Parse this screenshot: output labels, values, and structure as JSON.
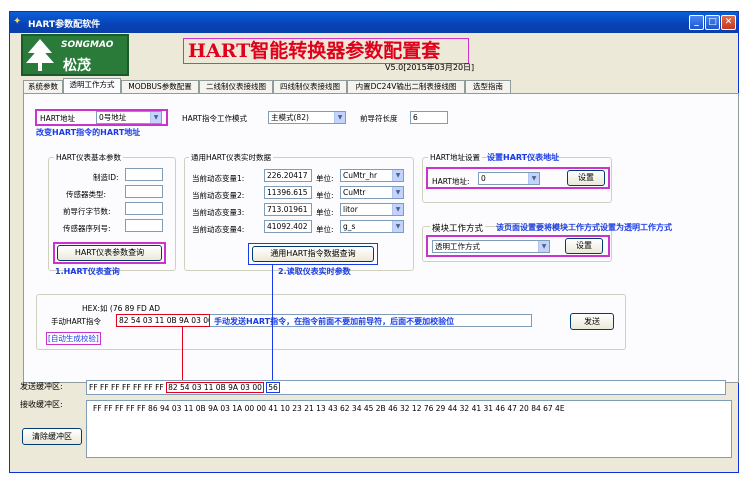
{
  "window": {
    "title": "HART参数配软件",
    "minimize_glyph": "_",
    "maximize_glyph": "□",
    "close_glyph": "✕"
  },
  "logo": {
    "brand": "SONGMAO",
    "brand_cn": "松茂"
  },
  "app_title": "HART智能转换器参数配置套",
  "version": "V5.0[2015年03月20日]",
  "tabs": [
    {
      "label": "系统参数"
    },
    {
      "label": "透明工作方式"
    },
    {
      "label": "MODBUS参数配置"
    },
    {
      "label": "二线制仪表接线图"
    },
    {
      "label": "四线制仪表接线图"
    },
    {
      "label": "内置DC24V输出二制表接线图"
    },
    {
      "label": "选型指南"
    }
  ],
  "hart_address": {
    "label": "HART地址",
    "value": "0号地址",
    "note": "改变HART指令的HART地址"
  },
  "work_mode": {
    "label": "HART指令工作模式",
    "value": "主模式(82)"
  },
  "preamble": {
    "label": "前导符长度",
    "value": "6"
  },
  "basic_params": {
    "title": "HART仪表基本参数",
    "rows": [
      {
        "label": "制造ID:",
        "value": ""
      },
      {
        "label": "传感器类型:",
        "value": ""
      },
      {
        "label": "前导行字节数:",
        "value": ""
      },
      {
        "label": "传感器序列号:",
        "value": ""
      }
    ],
    "query_button": "HART仪表参数查询",
    "note": "1.HART仪表查询"
  },
  "realtime": {
    "title": "通用HART仪表实时数据",
    "rows": [
      {
        "label": "当前动态变量1:",
        "value": "226.20417",
        "unit_label": "单位:",
        "unit": "CuMtr_hr"
      },
      {
        "label": "当前动态变量2:",
        "value": "11396.615",
        "unit_label": "单位:",
        "unit": "CuMtr"
      },
      {
        "label": "当前动态变量3:",
        "value": "713.01961",
        "unit_label": "单位:",
        "unit": "litor"
      },
      {
        "label": "当前动态变量4:",
        "value": "41092.402",
        "unit_label": "单位:",
        "unit": "g_s"
      }
    ],
    "query_button": "通用HART指令数据查询",
    "note": "2.读取仪表实时参数"
  },
  "addr_setting": {
    "title": "HART地址设置",
    "note": "设置HART仪表地址",
    "label": "HART地址:",
    "value": "0",
    "set_button": "设置"
  },
  "module_mode": {
    "title": "模块工作方式",
    "note": "该页面设置要将模块工作方式设置为透明工作方式",
    "value": "透明工作方式",
    "set_button": "设置"
  },
  "manual": {
    "hex_text": "HEX:如 (76 89 FD AD",
    "label": "手动HART指令",
    "value": "82 54 03 11 0B 9A 03 00",
    "note": "手动发送HART指令，在指令前面不要加前导符，后面不要加校验位",
    "auto_note": "[自动生成校验]",
    "send_button": "发送"
  },
  "send_buffer": {
    "label": "发送缓冲区:",
    "prefix": "FF FF FF FF FF FF FF",
    "command": "82 54 03 11 0B 9A 03 00",
    "checksum": "56"
  },
  "recv_buffer": {
    "label": "接收缓冲区:",
    "value": "FF FF FF FF FF 86 94 03 11 0B 9A 03 1A 00 00 41 10 23 21 13 43 62 34 45 2B 46 32 12 76 29 44 32 41 31 46 47 20 84 67 4E"
  },
  "clear_button": "清除缓冲区"
}
